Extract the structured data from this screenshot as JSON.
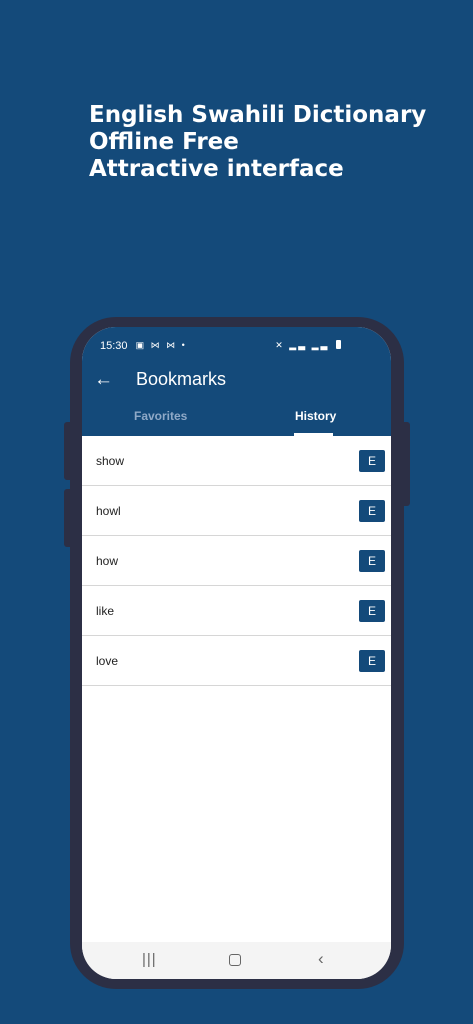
{
  "promo": {
    "line1": "English Swahili Dictionary",
    "line2": "Offline Free",
    "line3": "Attractive interface"
  },
  "status_bar": {
    "time": "15:30"
  },
  "app_bar": {
    "title": "Bookmarks",
    "back_icon": "arrow-left-icon"
  },
  "tabs": [
    {
      "label": "Favorites",
      "selected": false
    },
    {
      "label": "History",
      "selected": true
    }
  ],
  "history": [
    {
      "word": "show",
      "badge": "E"
    },
    {
      "word": "howl",
      "badge": "E"
    },
    {
      "word": "how",
      "badge": "E"
    },
    {
      "word": "like",
      "badge": "E"
    },
    {
      "word": "love",
      "badge": "E"
    }
  ],
  "colors": {
    "primary": "#144a7a",
    "phone_frame": "#2c2f45"
  }
}
